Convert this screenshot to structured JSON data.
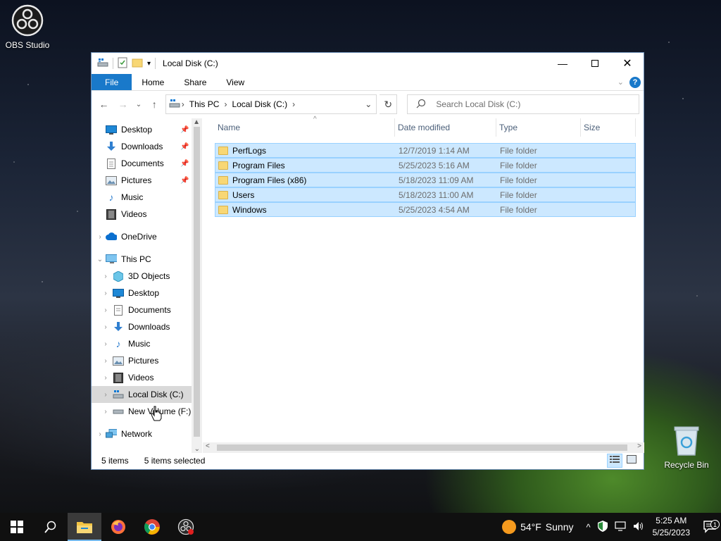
{
  "desktop": {
    "obs_label": "OBS Studio",
    "recycle_label": "Recycle Bin"
  },
  "window": {
    "title": "Local Disk (C:)",
    "ribbon_tabs": [
      "File",
      "Home",
      "Share",
      "View"
    ],
    "address": {
      "segments": [
        "This PC",
        "Local Disk (C:)"
      ]
    },
    "search_placeholder": "Search Local Disk (C:)",
    "nav_pane": {
      "quick_access": [
        {
          "label": "Desktop",
          "icon": "desktop-icon"
        },
        {
          "label": "Downloads",
          "icon": "download-arrow-icon"
        },
        {
          "label": "Documents",
          "icon": "document-icon"
        },
        {
          "label": "Pictures",
          "icon": "picture-icon"
        },
        {
          "label": "Music",
          "icon": "music-note-icon"
        },
        {
          "label": "Videos",
          "icon": "film-icon"
        }
      ],
      "onedrive": "OneDrive",
      "this_pc": "This PC",
      "this_pc_children": [
        {
          "label": "3D Objects",
          "icon": "cube-icon"
        },
        {
          "label": "Desktop",
          "icon": "desktop-icon"
        },
        {
          "label": "Documents",
          "icon": "document-icon"
        },
        {
          "label": "Downloads",
          "icon": "download-arrow-icon"
        },
        {
          "label": "Music",
          "icon": "music-note-icon"
        },
        {
          "label": "Pictures",
          "icon": "picture-icon"
        },
        {
          "label": "Videos",
          "icon": "film-icon"
        },
        {
          "label": "Local Disk (C:)",
          "icon": "drive-icon"
        },
        {
          "label": "New Volume (F:)",
          "icon": "drive-icon"
        }
      ],
      "network": "Network"
    },
    "columns": [
      "Name",
      "Date modified",
      "Type",
      "Size"
    ],
    "files": [
      {
        "name": "PerfLogs",
        "date": "12/7/2019 1:14 AM",
        "type": "File folder"
      },
      {
        "name": "Program Files",
        "date": "5/25/2023 5:16 AM",
        "type": "File folder"
      },
      {
        "name": "Program Files (x86)",
        "date": "5/18/2023 11:09 AM",
        "type": "File folder"
      },
      {
        "name": "Users",
        "date": "5/18/2023 11:00 AM",
        "type": "File folder"
      },
      {
        "name": "Windows",
        "date": "5/25/2023 4:54 AM",
        "type": "File folder"
      }
    ],
    "status": {
      "items": "5 items",
      "selected": "5 items selected"
    }
  },
  "taskbar": {
    "weather_temp": "54°F",
    "weather_desc": "Sunny",
    "time": "5:25 AM",
    "date": "5/25/2023",
    "notification_count": "1"
  }
}
